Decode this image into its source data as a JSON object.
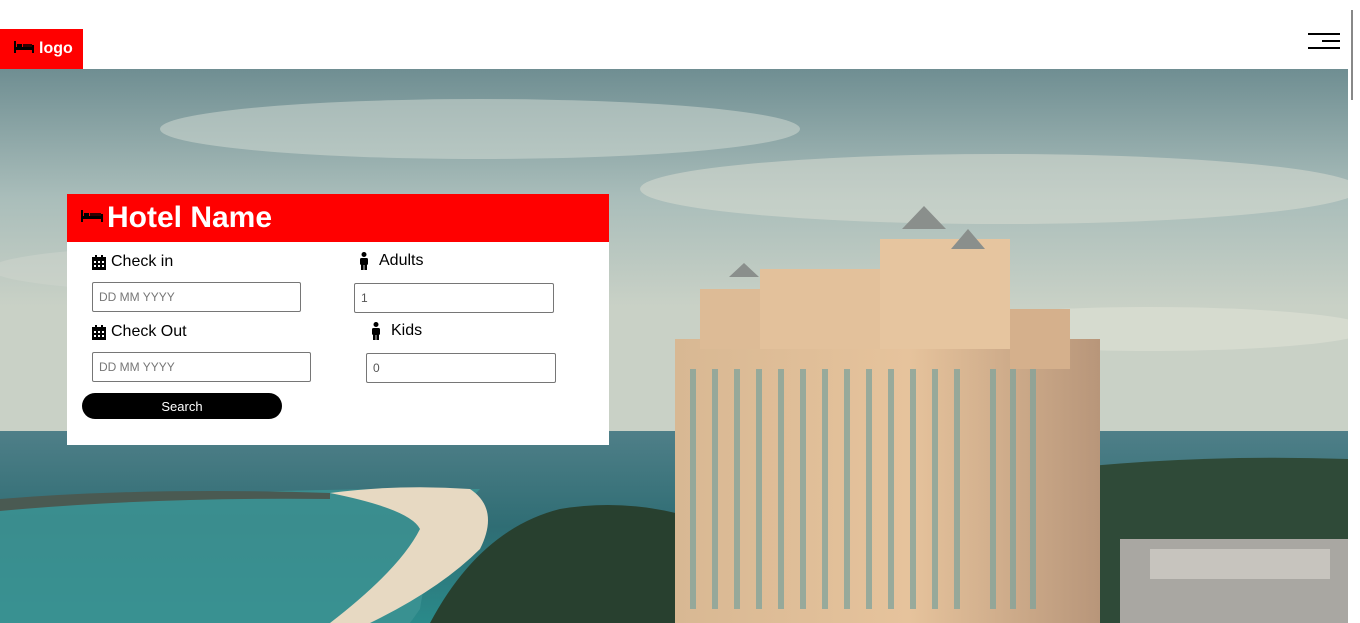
{
  "header": {
    "logo_label": "logo"
  },
  "booking": {
    "title": "Hotel Name",
    "check_in": {
      "label": "Check in",
      "placeholder": "DD MM YYYY"
    },
    "check_out": {
      "label": "Check Out",
      "placeholder": "DD MM YYYY"
    },
    "adults": {
      "label": "Adults",
      "value": "1"
    },
    "kids": {
      "label": "Kids",
      "value": "0"
    },
    "search_label": "Search"
  },
  "colors": {
    "brand": "#ff0000",
    "button": "#000000"
  },
  "icons": [
    "bed-icon",
    "calendar-icon",
    "person-icon",
    "hamburger-menu-icon"
  ]
}
